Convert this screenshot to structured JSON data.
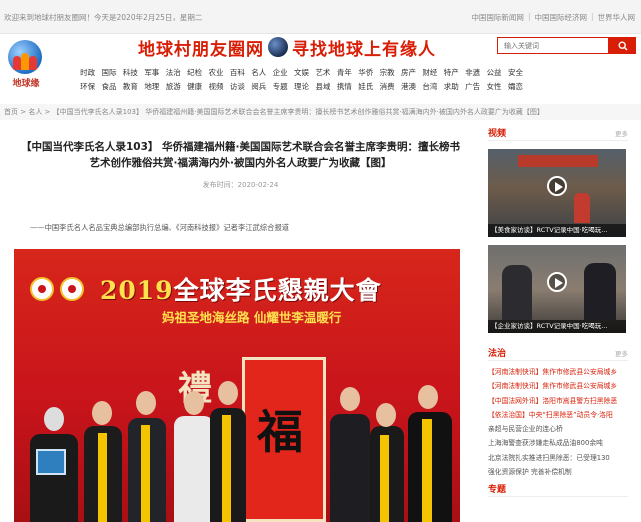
{
  "topbar": {
    "welcome": "欢迎来到地球村朋友圈网！今天是2020年2月25日，星期二",
    "links": [
      "中国国际新闻网",
      "中国国际经济网",
      "世界华人网"
    ]
  },
  "logo": {
    "text": "地球缘"
  },
  "slogan": {
    "left": "地球村朋友圈网",
    "right": "寻找地球上有缘人"
  },
  "search": {
    "placeholder": "输入关键词"
  },
  "nav": {
    "row1": [
      "时政",
      "国际",
      "科技",
      "军事",
      "法治",
      "纪检",
      "农业",
      "百科",
      "名人",
      "企业",
      "文娱",
      "艺术",
      "青年",
      "华侨",
      "宗教",
      "房产",
      "财经",
      "特产",
      "非遗",
      "公益",
      "安全"
    ],
    "row2": [
      "环保",
      "食品",
      "教育",
      "地理",
      "旅游",
      "健康",
      "视频",
      "访谈",
      "阅兵",
      "专题",
      "理论",
      "县域",
      "携情",
      "娃氏",
      "消费",
      "港澳",
      "台湾",
      "求助",
      "广告",
      "女性",
      "孀恋"
    ]
  },
  "breadcrumb": "首页 > 名人 > 【中国当代李氏名人录103】 华侨福建福州籍·美国国际艺术联合会名誉主席李贵明：擅长榜书艺术创作雅俗共赏·福满海内外·被国内外名人政要广为收藏【图】",
  "article": {
    "title": "【中国当代李氏名人录103】 华侨福建福州籍·美国国际艺术联合会名誉主席李贵明：擅长榜书艺术创作雅俗共赏·福满海内外·被国内外名人政要广为收藏【图】",
    "pubtime": "发布时间：2020-02-24",
    "lead": "——中国李氏名人名品宝典总编部执行总编、《河南科技报》记者李江武综合报道",
    "photo": {
      "year": "2019",
      "banner": "全球李氏懇親大會",
      "subtitle": "妈祖圣地海丝路  仙耀世李温暖行",
      "scroll_char": "福",
      "left_char": "禮"
    }
  },
  "sidebar": {
    "video": {
      "title": "视频",
      "more": "更多",
      "items": [
        {
          "caption": "【美食家访谈】RCTV记录中国·吃喝玩..."
        },
        {
          "caption": "【企业家访谈】RCTV记录中国·吃喝玩..."
        }
      ]
    },
    "law": {
      "title": "法治",
      "more": "更多",
      "items": [
        "【河南法制快讯】焦作市修武县公安局城乡",
        "【河南法制快讯】焦作市修武县公安局城乡",
        "【中国法网外讯】洛阳市嵩县警方扫黑除恶",
        "【依法治国】中央“扫黑除恶”动员令·洛阳",
        "亲超与民营企业的连心桥",
        "上海海警查获涉嫌走私成品油800余吨",
        "北京法院扎实推进扫黑除恶：已受理130",
        "强化资源保护 完善补偿机制"
      ],
      "red_count": 4
    },
    "next_title": "专题"
  },
  "colors": {
    "accent": "#d81e06"
  }
}
